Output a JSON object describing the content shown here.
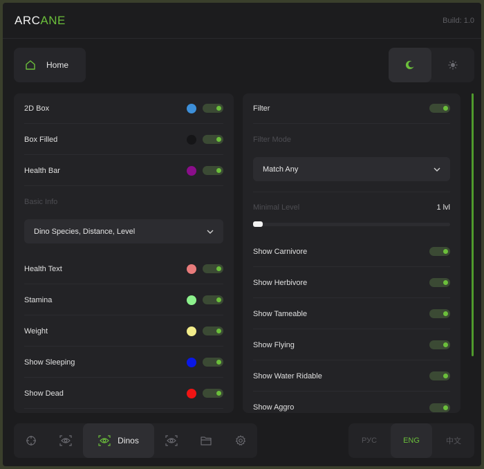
{
  "app": {
    "logo_main": "ARC",
    "logo_accent": "ANE",
    "build": "Build: 1.0"
  },
  "colors": {
    "accent": "#6bbf3b",
    "panel": "#232326",
    "background": "#1c1c1e"
  },
  "header": {
    "home_label": "Home",
    "home_icon": "home-icon",
    "theme_dark_icon": "moon-icon",
    "theme_light_icon": "sun-icon"
  },
  "left_panel": {
    "box2d": {
      "label": "2D Box",
      "color": "#3d8fd9",
      "enabled": true
    },
    "box_filled": {
      "label": "Box Filled",
      "color": "#151517",
      "enabled": true
    },
    "health_bar": {
      "label": "Health Bar",
      "color": "#8a0e8a",
      "enabled": true
    },
    "basic_info": {
      "label": "Basic Info",
      "value": "Dino Species, Distance, Level"
    },
    "health_text": {
      "label": "Health Text",
      "color": "#e87b7b",
      "enabled": true
    },
    "stamina": {
      "label": "Stamina",
      "color": "#8cf08c",
      "enabled": true
    },
    "weight": {
      "label": "Weight",
      "color": "#f2ec8a",
      "enabled": true
    },
    "show_sleeping": {
      "label": "Show Sleeping",
      "color": "#0a18e6",
      "enabled": true
    },
    "show_dead": {
      "label": "Show Dead",
      "color": "#f01414",
      "enabled": true
    }
  },
  "right_panel": {
    "filter": {
      "label": "Filter",
      "enabled": true
    },
    "filter_mode": {
      "label": "Filter Mode",
      "value": "Match Any"
    },
    "minimal_level": {
      "label": "Minimal Level",
      "value": "1 lvl",
      "fraction": 0.0
    },
    "show_carnivore": {
      "label": "Show Carnivore",
      "enabled": true
    },
    "show_herbivore": {
      "label": "Show Herbivore",
      "enabled": true
    },
    "show_tameable": {
      "label": "Show Tameable",
      "enabled": true
    },
    "show_flying": {
      "label": "Show Flying",
      "enabled": true
    },
    "show_water_ridable": {
      "label": "Show Water Ridable",
      "enabled": true
    },
    "show_aggro": {
      "label": "Show Aggro",
      "enabled": true
    }
  },
  "bottom_nav": {
    "items": [
      {
        "icon": "crosshair-icon"
      },
      {
        "icon": "eye-scan-icon"
      },
      {
        "icon": "eye-scan-icon",
        "label": "Dinos",
        "active": true
      },
      {
        "icon": "eye-scan-icon"
      },
      {
        "icon": "folder-icon"
      },
      {
        "icon": "gear-icon"
      }
    ]
  },
  "languages": {
    "ru": "РУС",
    "en": "ENG",
    "zh": "中文",
    "active": "ENG"
  }
}
